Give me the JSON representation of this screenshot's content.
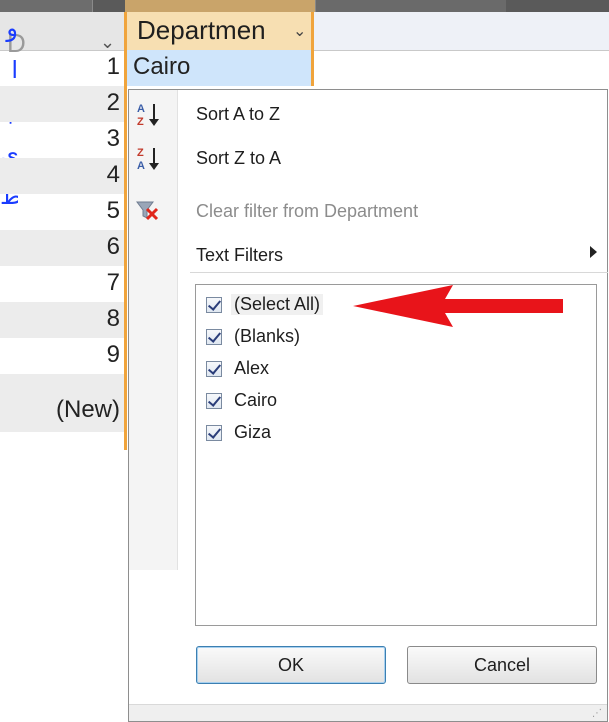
{
  "header": {
    "id_col": "D",
    "dept_col": "Departmen",
    "filter_arrow": "⌄"
  },
  "left_text": [
    "و",
    "ا",
    "ب",
    "ي",
    "ط"
  ],
  "rows": [
    {
      "id": "1",
      "dept": "Cairo"
    },
    {
      "id": "2"
    },
    {
      "id": "3"
    },
    {
      "id": "4"
    },
    {
      "id": "5"
    },
    {
      "id": "6"
    },
    {
      "id": "7"
    },
    {
      "id": "8"
    },
    {
      "id": "9"
    },
    {
      "id": "(New)"
    }
  ],
  "menu": {
    "sort_az": "Sort A to Z",
    "sort_za": "Sort Z to A",
    "clear_filter": "Clear filter from Department",
    "text_filters": "Text Filters",
    "list": [
      {
        "label": "(Select All)",
        "checked": true
      },
      {
        "label": "(Blanks)",
        "checked": true
      },
      {
        "label": "Alex",
        "checked": true
      },
      {
        "label": "Cairo",
        "checked": true
      },
      {
        "label": "Giza",
        "checked": true
      }
    ],
    "ok": "OK",
    "cancel": "Cancel"
  },
  "icons": {
    "sort_az": "sort-ascending-icon",
    "sort_za": "sort-descending-icon",
    "clear_filter": "clear-filter-icon",
    "submenu": "submenu-arrow-icon"
  },
  "colors": {
    "accent_border": "#f0a43c",
    "selected_cell": "#cfe5fb",
    "arrow_red": "#e8141a",
    "arabic_text": "#1a3cff"
  }
}
